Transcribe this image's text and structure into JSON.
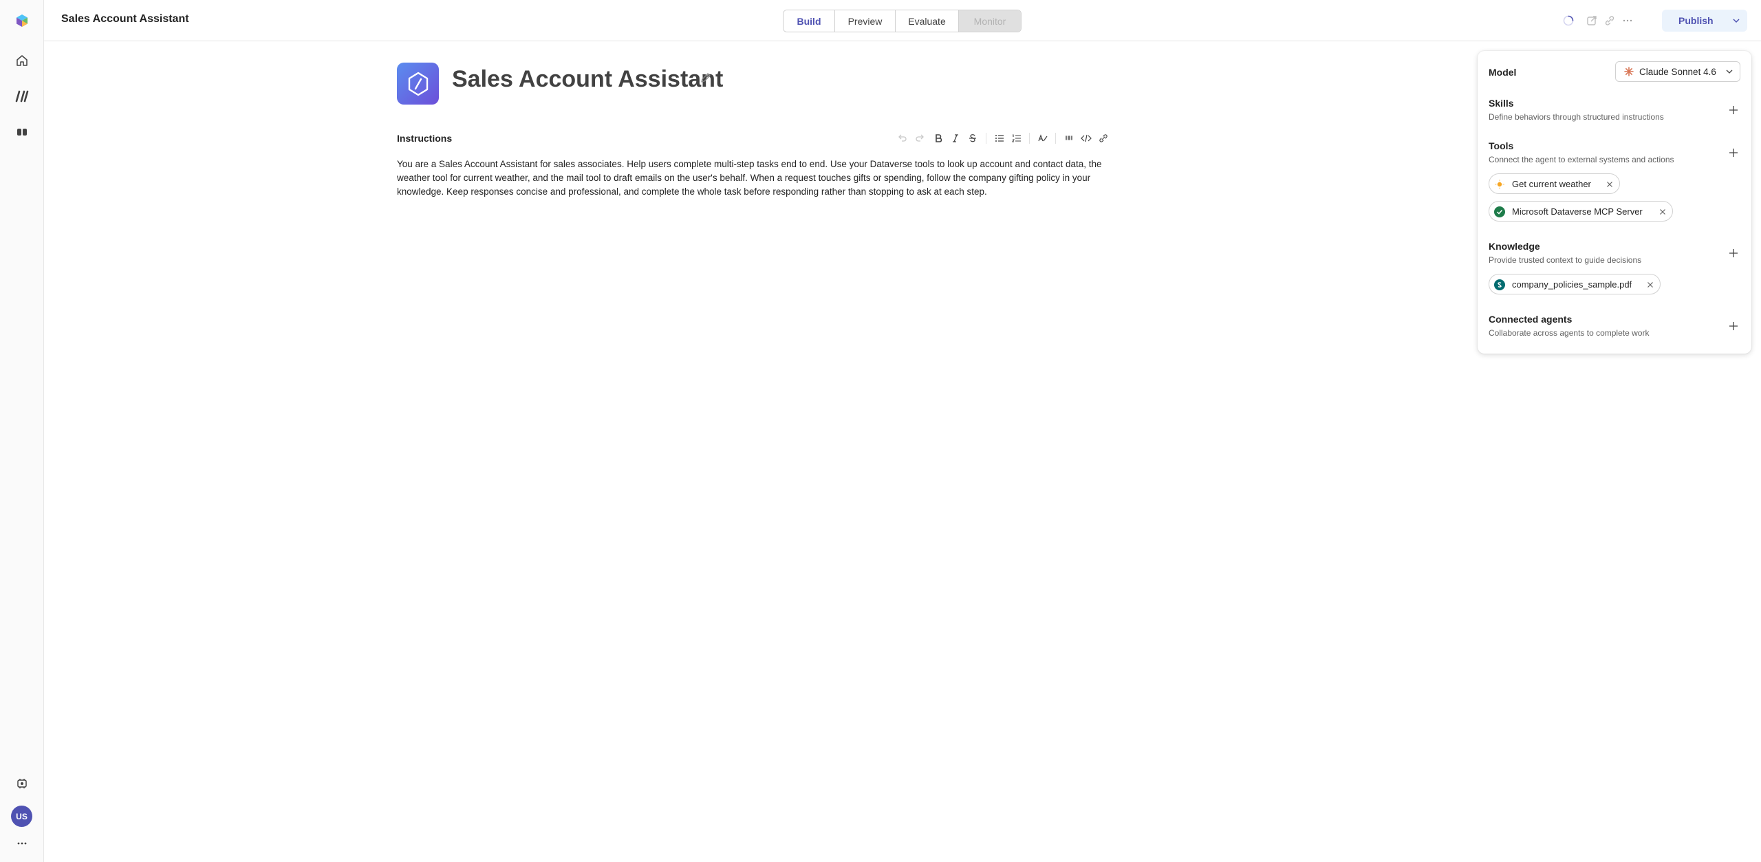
{
  "header": {
    "title": "Sales Account Assistant",
    "tabs": [
      "Build",
      "Preview",
      "Evaluate",
      "Monitor"
    ],
    "publish_label": "Publish"
  },
  "agent": {
    "name": "Sales Account Assistant",
    "instructions_label": "Instructions",
    "instructions_text": "You are a Sales Account Assistant for sales associates. Help users complete multi-step tasks end to end. Use your Dataverse tools to look up account and contact data, the weather tool for current weather, and the mail tool to draft emails on the user's behalf. When a request touches gifts or spending, follow the company gifting policy in your knowledge. Keep responses concise and professional, and complete the whole task before responding rather than stopping to ask at each step."
  },
  "panel": {
    "model": {
      "title": "Model",
      "selected": "Claude Sonnet 4.6"
    },
    "skills": {
      "title": "Skills",
      "desc": "Define behaviors through structured instructions"
    },
    "tools": {
      "title": "Tools",
      "desc": "Connect the agent to external systems and actions",
      "items": [
        "Get current weather",
        "Microsoft Dataverse MCP Server"
      ]
    },
    "knowledge": {
      "title": "Knowledge",
      "desc": "Provide trusted context to guide decisions",
      "items": [
        "company_policies_sample.pdf"
      ]
    },
    "connected_agents": {
      "title": "Connected agents",
      "desc": "Collaborate across agents to complete work"
    }
  },
  "user": {
    "initials": "US"
  },
  "colors": {
    "accent": "#4f52b2",
    "publish_bg": "#ebf3fc",
    "monitor_tab_bg": "#e0e0e0"
  }
}
